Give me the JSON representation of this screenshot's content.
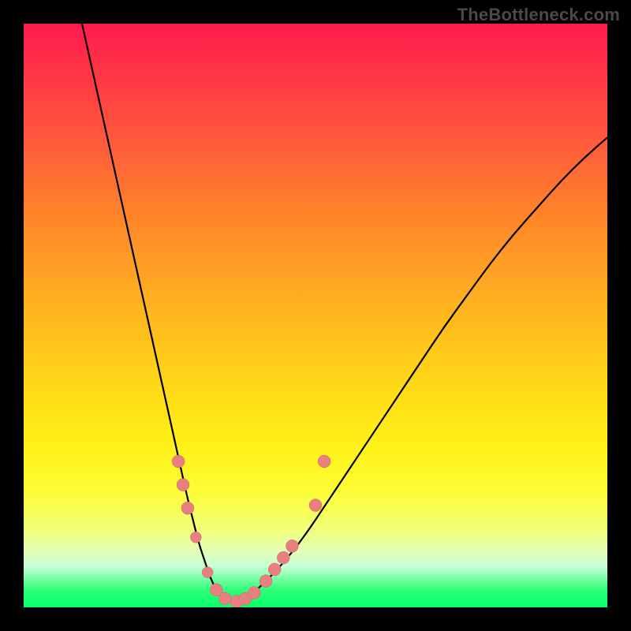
{
  "watermark": "TheBottleneck.com",
  "colors": {
    "background": "#000000",
    "curve_stroke": "#000000",
    "marker_fill": "#e88080",
    "marker_stroke": "#cc6666"
  },
  "chart_data": {
    "type": "line",
    "title": "",
    "xlabel": "",
    "ylabel": "",
    "xlim": [
      0,
      100
    ],
    "ylim": [
      0,
      100
    ],
    "grid": false,
    "series": [
      {
        "name": "bottleneck-curve",
        "x": [
          10,
          12,
          14,
          16,
          18,
          20,
          22,
          24,
          26,
          27,
          28,
          29,
          30,
          31,
          32,
          33,
          34,
          36,
          38,
          40,
          44,
          48,
          52,
          56,
          60,
          64,
          68,
          72,
          76,
          80,
          84,
          88,
          92,
          96,
          100
        ],
        "y": [
          100,
          91,
          82,
          73,
          64,
          55,
          46,
          37,
          28,
          23.5,
          19,
          15,
          11,
          8,
          5,
          3,
          2,
          1,
          1.5,
          3,
          7,
          12,
          18,
          24,
          30,
          36,
          42,
          48,
          53.5,
          59,
          64,
          68.5,
          73,
          77,
          80.5
        ]
      }
    ],
    "markers": [
      {
        "x": 26.5,
        "y": 25,
        "r": 8
      },
      {
        "x": 27.3,
        "y": 21,
        "r": 8
      },
      {
        "x": 28.1,
        "y": 17,
        "r": 8
      },
      {
        "x": 29.5,
        "y": 12,
        "r": 7
      },
      {
        "x": 31.5,
        "y": 6,
        "r": 7
      },
      {
        "x": 33.0,
        "y": 3,
        "r": 8
      },
      {
        "x": 34.5,
        "y": 1.5,
        "r": 8
      },
      {
        "x": 36.5,
        "y": 1,
        "r": 8
      },
      {
        "x": 38.0,
        "y": 1.5,
        "r": 8
      },
      {
        "x": 39.5,
        "y": 2.5,
        "r": 8
      },
      {
        "x": 41.5,
        "y": 4.5,
        "r": 8
      },
      {
        "x": 43.0,
        "y": 6.5,
        "r": 8
      },
      {
        "x": 44.5,
        "y": 8.5,
        "r": 8
      },
      {
        "x": 46.0,
        "y": 10.5,
        "r": 8
      },
      {
        "x": 50.0,
        "y": 17.5,
        "r": 8
      },
      {
        "x": 51.5,
        "y": 25.0,
        "r": 8
      }
    ]
  }
}
